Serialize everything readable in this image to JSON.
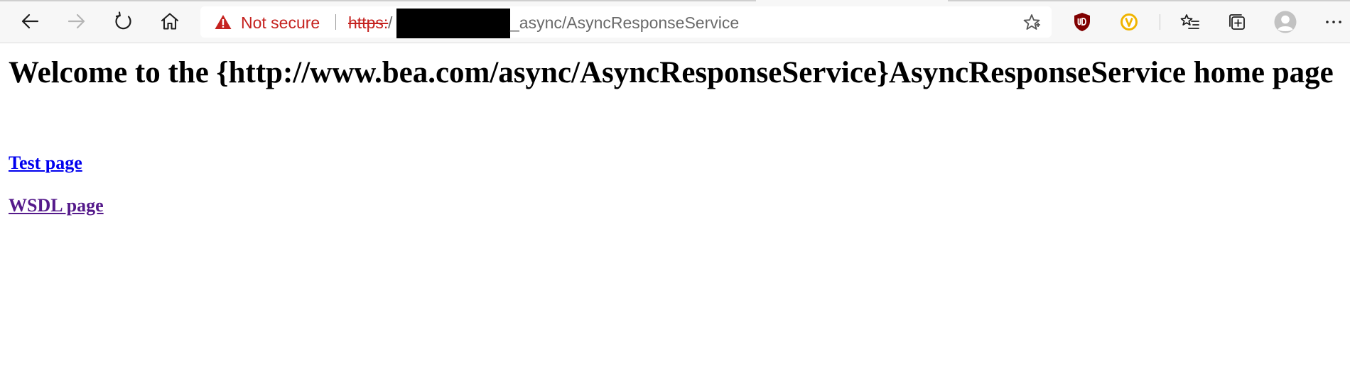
{
  "browser": {
    "toolbar": {
      "back_icon": "back-arrow-icon",
      "forward_icon": "forward-arrow-icon",
      "reload_icon": "reload-icon",
      "home_icon": "home-icon"
    },
    "address_bar": {
      "security_icon": "warning-triangle-icon",
      "security_label": "Not secure",
      "url_scheme": "https:",
      "url_slash": "/",
      "url_path": "_async/AsyncResponseService",
      "favorite_icon": "star-icon"
    },
    "extensions": [
      {
        "icon": "ublock-shield-icon",
        "color": "#800000"
      },
      {
        "icon": "v-badge-icon",
        "color": "#f0b400"
      }
    ],
    "right_icons": [
      "favorites-list-icon",
      "collections-icon",
      "profile-avatar-icon",
      "more-menu-icon"
    ],
    "colors": {
      "insecure": "#c5221f",
      "url_text": "#6a6a6a",
      "toolbar_bg": "#f7f7f7"
    }
  },
  "page": {
    "title": "Welcome to the {http://www.bea.com/async/AsyncResponseService}AsyncResponseService home page",
    "links": [
      {
        "label": "Test page",
        "color": "#0000ee"
      },
      {
        "label": "WSDL page",
        "color": "#551a8b"
      }
    ]
  }
}
